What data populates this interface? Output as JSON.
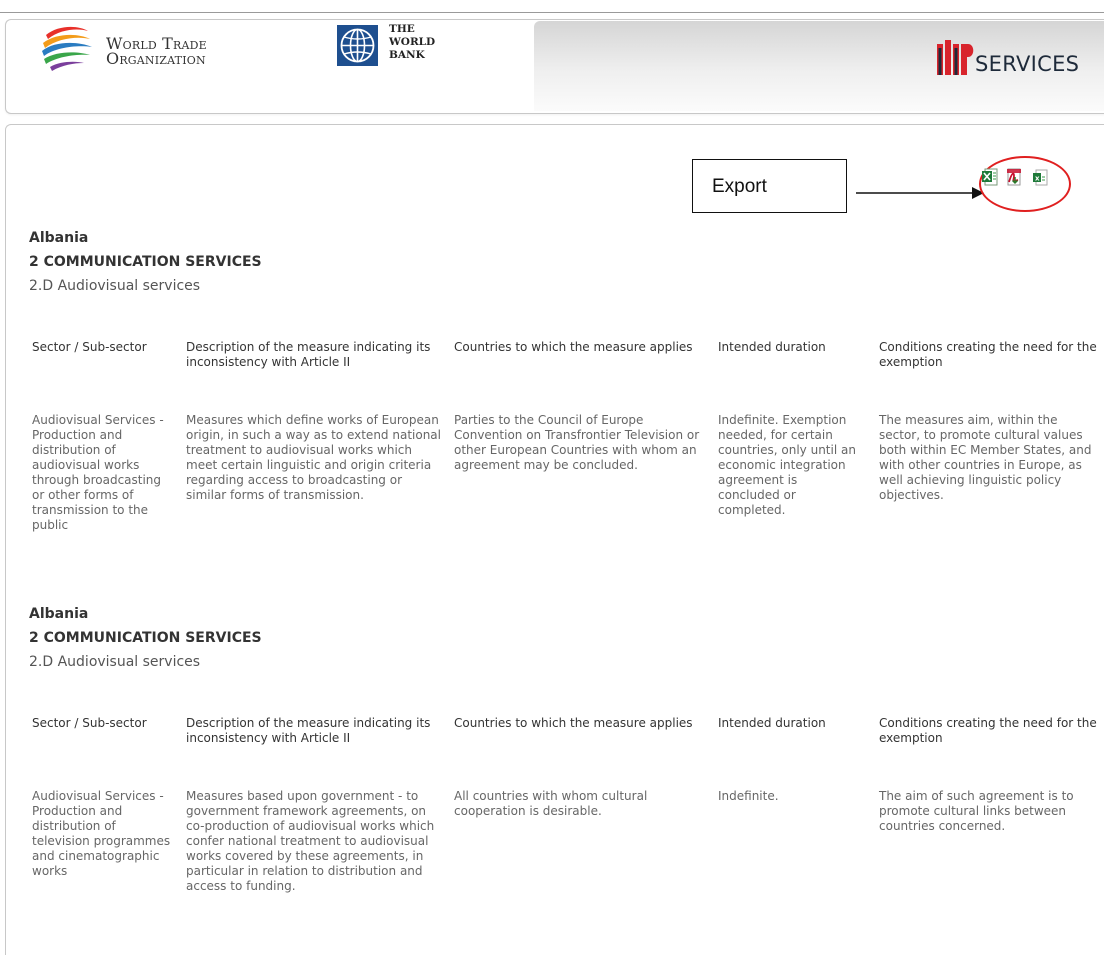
{
  "header": {
    "wto_line1": "World Trade",
    "wto_line2": "Organization",
    "wb_line1": "THE",
    "wb_line2": "WORLD",
    "wb_line3": "BANK",
    "services_text": "SERVICES",
    "icons": [
      "wto-logo-icon",
      "world-bank-globe-icon",
      "iip-logo-icon"
    ]
  },
  "export": {
    "label": "Export",
    "icons": [
      "excel-icon",
      "pdf-icon",
      "csv-icon"
    ],
    "accent_color": "#e02020"
  },
  "records": [
    {
      "country": "Albania",
      "sector": "2 COMMUNICATION SERVICES",
      "subsector": "2.D Audiovisual services",
      "headers": [
        "Sector / Sub-sector",
        "Description of the measure indicating its inconsistency with Article II",
        "Countries to which the measure applies",
        "Intended duration",
        "Conditions creating the need for the exemption"
      ],
      "cells": [
        "Audiovisual Services - Production and distribution of audiovisual works through broadcasting or other forms of transmission to the public",
        "Measures which define works of European origin, in such a way as to extend national treatment to audiovisual works which meet certain linguistic and origin criteria regarding access to broadcasting or similar forms of transmission.",
        "Parties to the Council of Europe Convention on Transfrontier Television or other European Countries with whom an agreement may be concluded.",
        "Indefinite. Exemption needed, for certain countries, only until an economic integration agreement is concluded or completed.",
        "The measures aim, within the sector, to promote cultural values both within EC Member States, and with other countries in Europe, as well achieving linguistic policy objectives."
      ]
    },
    {
      "country": "Albania",
      "sector": "2 COMMUNICATION SERVICES",
      "subsector": "2.D Audiovisual services",
      "headers": [
        "Sector / Sub-sector",
        "Description of the measure indicating its inconsistency with Article II",
        "Countries to which the measure applies",
        "Intended duration",
        "Conditions creating the need for the exemption"
      ],
      "cells": [
        "Audiovisual Services - Production and distribution of television programmes and cinematographic works",
        "Measures based upon government - to government framework agreements, on co-production of audiovisual works which confer national treatment to audiovisual works covered by these agreements, in particular in relation to distribution and access to funding.",
        "All countries with whom cultural cooperation is desirable.",
        "Indefinite.",
        "The aim of such agreement is to promote cultural links between countries concerned."
      ]
    }
  ]
}
